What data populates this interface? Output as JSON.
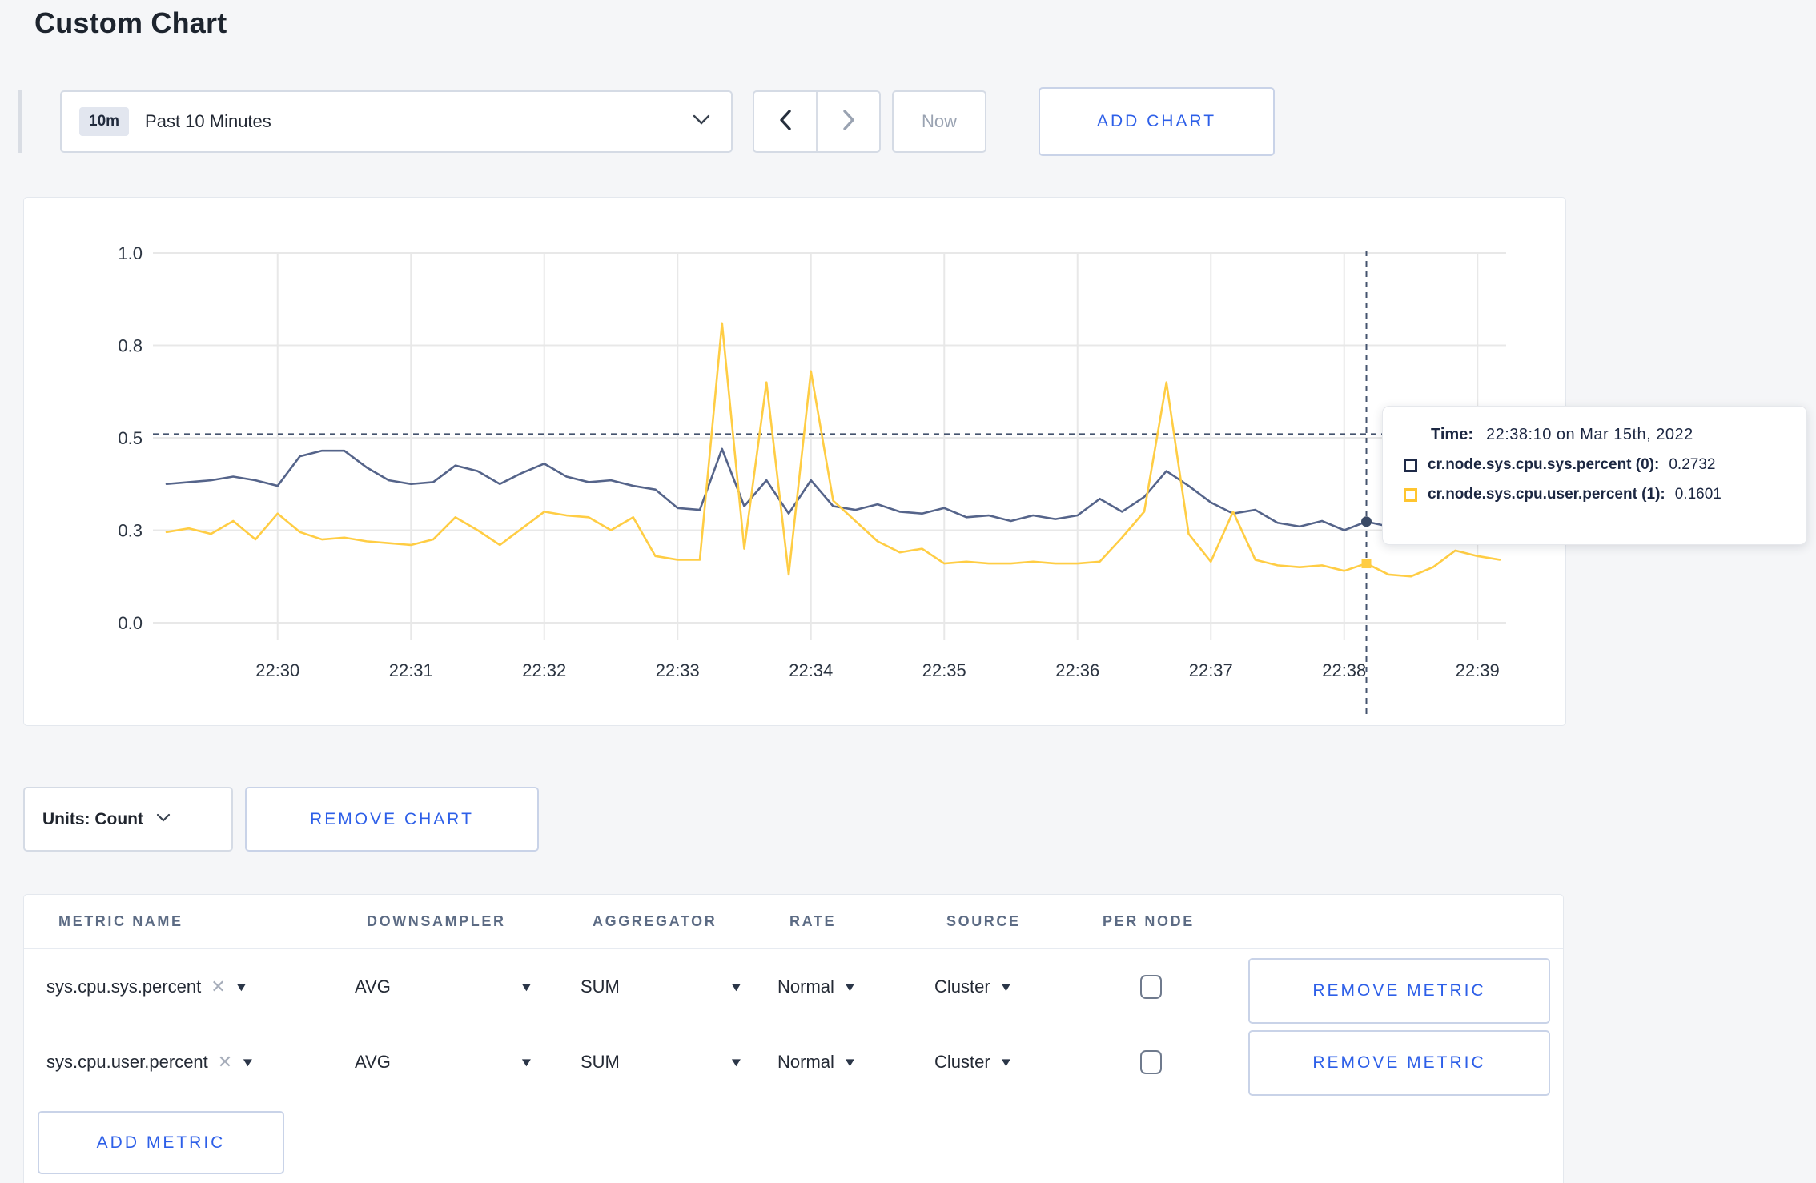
{
  "page": {
    "title": "Custom Chart"
  },
  "toolbar": {
    "range_badge": "10m",
    "range_label": "Past 10 Minutes",
    "prev_label": "previous time window",
    "next_label": "next time window",
    "now_label": "Now",
    "add_chart_label": "ADD CHART"
  },
  "chart_controls": {
    "units_label": "Units: Count",
    "remove_chart_label": "REMOVE CHART"
  },
  "tooltip": {
    "time_label": "Time:",
    "time_value": "22:38:10 on Mar 15th, 2022",
    "series": [
      {
        "label": "cr.node.sys.cpu.sys.percent (0):",
        "value": "0.2732",
        "swatch_color": "#1F2A48"
      },
      {
        "label": "cr.node.sys.cpu.user.percent (1):",
        "value": "0.1601",
        "swatch_color": "#FFC530"
      }
    ]
  },
  "chart_data": {
    "type": "line",
    "title": "",
    "xlabel": "",
    "ylabel": "",
    "ylim": [
      0,
      1
    ],
    "x_start": "22:29:10",
    "x_end": "22:39:10",
    "x_step_seconds": 10,
    "x_tick_labels": [
      "22:30",
      "22:31",
      "22:32",
      "22:33",
      "22:34",
      "22:35",
      "22:36",
      "22:37",
      "22:38",
      "22:39"
    ],
    "y_ticks": [
      {
        "v": 0,
        "label": "0.0"
      },
      {
        "v": 0.25,
        "label": "0.3"
      },
      {
        "v": 0.5,
        "label": "0.5"
      },
      {
        "v": 0.75,
        "label": "0.8"
      },
      {
        "v": 1,
        "label": "1.0"
      }
    ],
    "grid": true,
    "legend": "none",
    "hover": {
      "index": 54,
      "time": "22:38:10",
      "hline_value": 0.51,
      "marker_values": [
        0.2732,
        0.1601
      ]
    },
    "series": [
      {
        "name": "cr.node.sys.cpu.sys.percent",
        "color": "#55648A",
        "values": [
          0.375,
          0.38,
          0.385,
          0.395,
          0.385,
          0.37,
          0.45,
          0.465,
          0.465,
          0.42,
          0.385,
          0.375,
          0.38,
          0.425,
          0.41,
          0.375,
          0.405,
          0.43,
          0.395,
          0.38,
          0.385,
          0.37,
          0.36,
          0.31,
          0.305,
          0.47,
          0.315,
          0.385,
          0.295,
          0.385,
          0.315,
          0.305,
          0.32,
          0.3,
          0.295,
          0.31,
          0.285,
          0.29,
          0.275,
          0.29,
          0.28,
          0.29,
          0.335,
          0.3,
          0.34,
          0.41,
          0.37,
          0.325,
          0.295,
          0.305,
          0.27,
          0.26,
          0.275,
          0.25,
          0.2732,
          0.26,
          0.255,
          0.265,
          0.275,
          0.28,
          0.28
        ]
      },
      {
        "name": "cr.node.sys.cpu.user.percent",
        "color": "#FFCD44",
        "values": [
          0.245,
          0.255,
          0.24,
          0.275,
          0.225,
          0.295,
          0.245,
          0.225,
          0.23,
          0.22,
          0.215,
          0.21,
          0.225,
          0.285,
          0.25,
          0.21,
          0.255,
          0.3,
          0.29,
          0.285,
          0.25,
          0.285,
          0.18,
          0.17,
          0.17,
          0.81,
          0.2,
          0.65,
          0.13,
          0.68,
          0.33,
          0.275,
          0.22,
          0.19,
          0.2,
          0.16,
          0.165,
          0.16,
          0.16,
          0.165,
          0.16,
          0.16,
          0.165,
          0.23,
          0.3,
          0.65,
          0.24,
          0.165,
          0.3,
          0.17,
          0.155,
          0.15,
          0.155,
          0.14,
          0.1601,
          0.13,
          0.125,
          0.15,
          0.195,
          0.18,
          0.17
        ]
      }
    ],
    "style": {
      "gridline_color": "#e8e8e8",
      "tick_label_color": "#2c3542",
      "crosshair_color": "#44536e"
    }
  },
  "metrics_table": {
    "headers": [
      "METRIC NAME",
      "DOWNSAMPLER",
      "AGGREGATOR",
      "RATE",
      "SOURCE",
      "PER NODE"
    ],
    "rows": [
      {
        "metric": "sys.cpu.sys.percent",
        "downsampler": "AVG",
        "aggregator": "SUM",
        "rate": "Normal",
        "source": "Cluster",
        "per_node": false,
        "action": "REMOVE METRIC"
      },
      {
        "metric": "sys.cpu.user.percent",
        "downsampler": "AVG",
        "aggregator": "SUM",
        "rate": "Normal",
        "source": "Cluster",
        "per_node": false,
        "action": "REMOVE METRIC"
      }
    ],
    "add_metric_label": "ADD METRIC"
  }
}
